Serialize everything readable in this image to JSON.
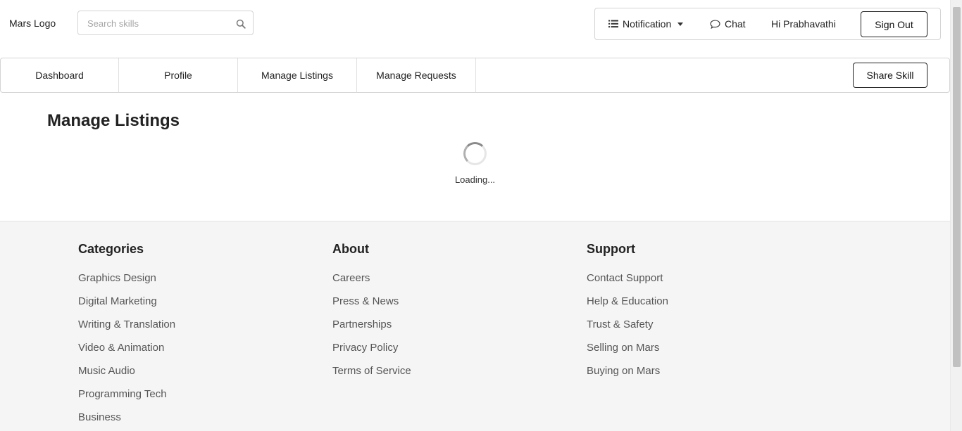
{
  "header": {
    "logo": "Mars Logo",
    "search": {
      "placeholder": "Search skills",
      "icon": "search-icon"
    },
    "menu": {
      "notification_label": "Notification",
      "chat_label": "Chat",
      "greeting": "Hi Prabhavathi",
      "signout_label": "Sign Out"
    }
  },
  "nav": {
    "tabs": [
      {
        "label": "Dashboard"
      },
      {
        "label": "Profile"
      },
      {
        "label": "Manage Listings"
      },
      {
        "label": "Manage Requests"
      }
    ],
    "share_label": "Share Skill"
  },
  "main": {
    "title": "Manage Listings",
    "loading_text": "Loading..."
  },
  "footer": {
    "columns": [
      {
        "heading": "Categories",
        "links": [
          "Graphics Design",
          "Digital Marketing",
          "Writing & Translation",
          "Video & Animation",
          "Music Audio",
          "Programming Tech",
          "Business"
        ]
      },
      {
        "heading": "About",
        "links": [
          "Careers",
          "Press & News",
          "Partnerships",
          "Privacy Policy",
          "Terms of Service"
        ]
      },
      {
        "heading": "Support",
        "links": [
          "Contact Support",
          "Help & Education",
          "Trust & Safety",
          "Selling on Mars",
          "Buying on Mars"
        ]
      }
    ]
  },
  "colors": {
    "border": "#d4d4d5",
    "footer_bg": "#f5f5f5",
    "text": "#222222",
    "muted_text": "#555555"
  }
}
